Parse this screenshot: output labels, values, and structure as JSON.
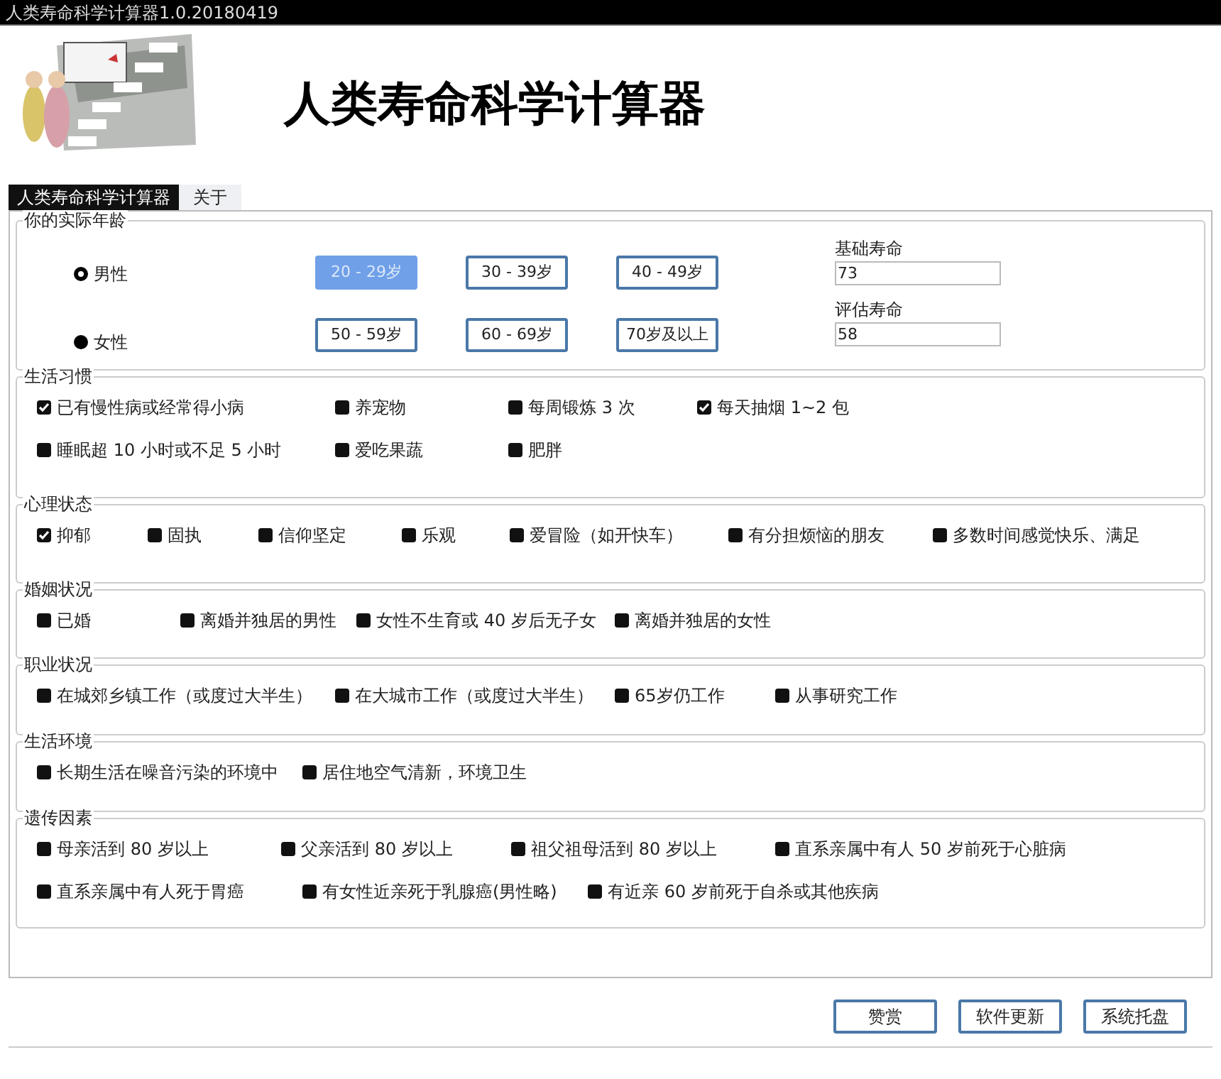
{
  "window": {
    "title": "人类寿命科学计算器1.0.20180419"
  },
  "header": {
    "title": "人类寿命科学计算器"
  },
  "tabs": [
    {
      "label": "人类寿命科学计算器",
      "selected": true
    },
    {
      "label": "关于",
      "selected": false
    }
  ],
  "age": {
    "title": "你的实际年龄",
    "genders": [
      {
        "label": "男性",
        "selected": true
      },
      {
        "label": "女性",
        "selected": false
      }
    ],
    "ranges": [
      {
        "label": "20 - 29岁",
        "selected": true
      },
      {
        "label": "30 - 39岁",
        "selected": false
      },
      {
        "label": "40 - 49岁",
        "selected": false
      },
      {
        "label": "50 - 59岁",
        "selected": false
      },
      {
        "label": "60 - 69岁",
        "selected": false
      },
      {
        "label": "70岁及以上",
        "selected": false
      }
    ],
    "fields": [
      {
        "label": "基础寿命",
        "value": "73"
      },
      {
        "label": "评估寿命",
        "value": "58"
      }
    ]
  },
  "sections": [
    {
      "title": "生活习惯",
      "rows": [
        [
          {
            "label": "已有慢性病或经常得小病",
            "checked": true
          },
          {
            "label": "养宠物",
            "checked": false
          },
          {
            "label": "每周锻炼 3 次",
            "checked": false
          },
          {
            "label": "每天抽烟 1~2 包",
            "checked": true
          }
        ],
        [
          {
            "label": "睡眠超 10 小时或不足 5 小时",
            "checked": false
          },
          {
            "label": "爱吃果蔬",
            "checked": false
          },
          {
            "label": "肥胖",
            "checked": false
          }
        ]
      ]
    },
    {
      "title": "心理状态",
      "rows": [
        [
          {
            "label": "抑郁",
            "checked": true
          },
          {
            "label": "固执",
            "checked": false
          },
          {
            "label": "信仰坚定",
            "checked": false
          },
          {
            "label": "乐观",
            "checked": false
          },
          {
            "label": "爱冒险（如开快车）",
            "checked": false
          },
          {
            "label": "有分担烦恼的朋友",
            "checked": false
          },
          {
            "label": "多数时间感觉快乐、满足",
            "checked": false
          }
        ]
      ]
    },
    {
      "title": "婚姻状况",
      "rows": [
        [
          {
            "label": "已婚",
            "checked": false
          },
          {
            "label": "离婚并独居的男性",
            "checked": false
          },
          {
            "label": "女性不生育或 40 岁后无子女",
            "checked": false
          },
          {
            "label": "离婚并独居的女性",
            "checked": false
          }
        ]
      ]
    },
    {
      "title": "职业状况",
      "rows": [
        [
          {
            "label": "在城郊乡镇工作（或度过大半生）",
            "checked": false
          },
          {
            "label": "在大城市工作（或度过大半生）",
            "checked": false
          },
          {
            "label": "65岁仍工作",
            "checked": false
          },
          {
            "label": "从事研究工作",
            "checked": false
          }
        ]
      ]
    },
    {
      "title": "生活环境",
      "rows": [
        [
          {
            "label": "长期生活在噪音污染的环境中",
            "checked": false
          },
          {
            "label": "居住地空气清新，环境卫生",
            "checked": false
          }
        ]
      ]
    },
    {
      "title": "遗传因素",
      "rows": [
        [
          {
            "label": "母亲活到 80 岁以上",
            "checked": false
          },
          {
            "label": "父亲活到 80 岁以上",
            "checked": false
          },
          {
            "label": "祖父祖母活到 80 岁以上",
            "checked": false
          },
          {
            "label": "直系亲属中有人 50 岁前死于心脏病",
            "checked": false
          }
        ],
        [
          {
            "label": "直系亲属中有人死于胃癌",
            "checked": false
          },
          {
            "label": "有女性近亲死于乳腺癌(男性略)",
            "checked": false
          },
          {
            "label": "有近亲 60 岁前死于自杀或其他疾病",
            "checked": false
          }
        ]
      ]
    }
  ],
  "buttons": [
    "赞赏",
    "软件更新",
    "系统托盘"
  ]
}
